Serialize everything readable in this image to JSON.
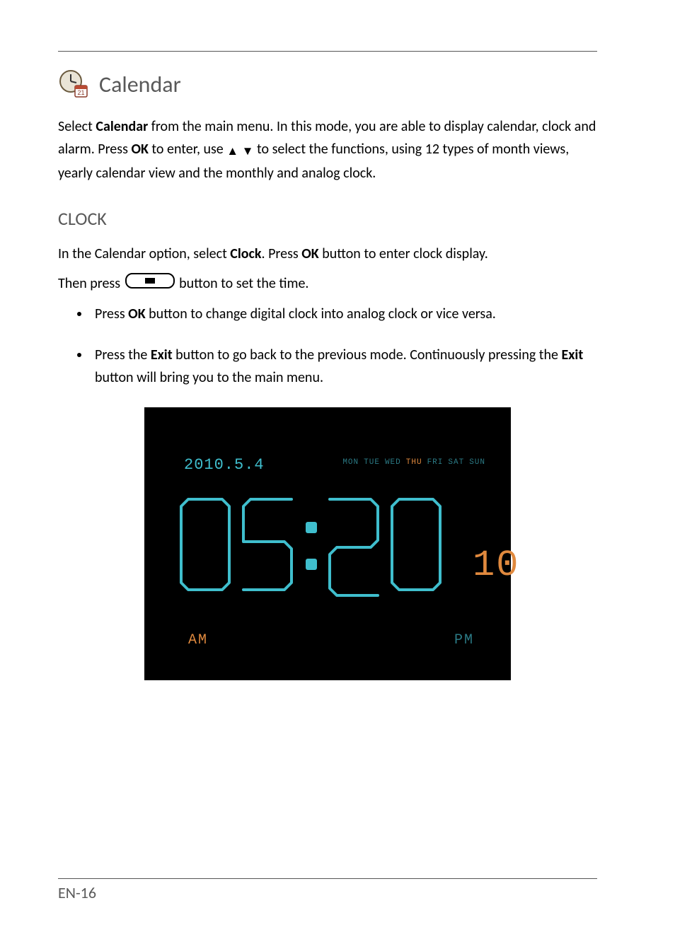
{
  "section": {
    "title": "Calendar"
  },
  "intro": {
    "p1_a": "Select ",
    "p1_b": "Calendar",
    "p1_c": " from the main menu. In this mode, you are able to display calendar, clock and alarm. Press ",
    "p1_d": "OK",
    "p1_e": " to enter, use ",
    "p1_f": " to select the functions, using 12 types of month views, yearly calendar view and the monthly and analog clock."
  },
  "clock": {
    "heading": "CLOCK",
    "lead_a": "In the Calendar option, select ",
    "lead_b": "Clock",
    "lead_c": ". Press ",
    "lead_d": "OK",
    "lead_e": " button to enter clock display.",
    "line2_a": "Then press ",
    "line2_b": " button to set the time.",
    "bullets": [
      {
        "a": "Press ",
        "b": "OK",
        "c": " button to change digital clock into analog clock or vice versa."
      },
      {
        "a": "Press the ",
        "b": "Exit",
        "c": " button to go back to the previous mode. Continuously pressing the ",
        "d": "Exit",
        "e": " button will bring you to the main menu."
      }
    ]
  },
  "clock_display": {
    "date": "2010.5.4",
    "days": [
      "MON",
      "TUE",
      "WED",
      "THU",
      "FRI",
      "SAT",
      "SUN"
    ],
    "active_day_index": 3,
    "time_hh": "05",
    "time_mm": "20",
    "time_ss": "10",
    "am": "AM",
    "pm": "PM"
  },
  "footer": {
    "page": "EN-16"
  }
}
